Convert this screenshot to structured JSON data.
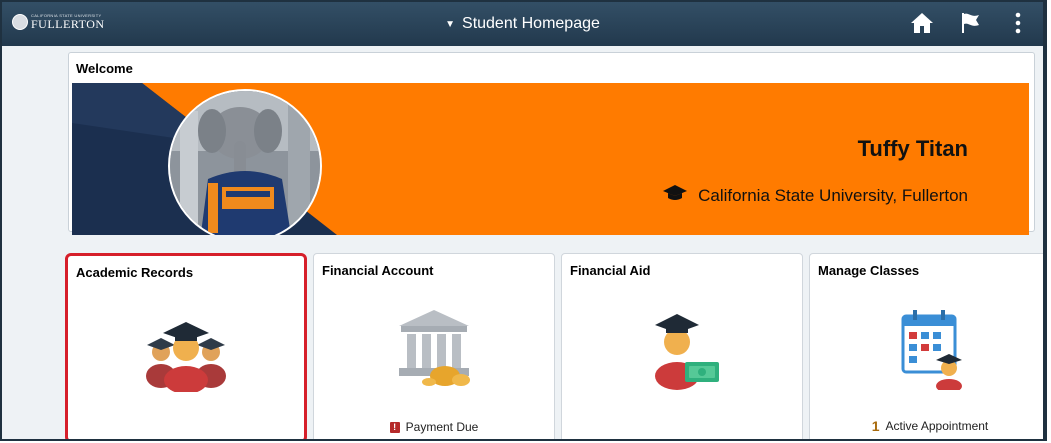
{
  "header": {
    "logo": {
      "small_text": "CALIFORNIA STATE UNIVERSITY",
      "big_text": "FULLERTON"
    },
    "title": "Student Homepage",
    "icons": [
      "caret-down-icon",
      "home-icon",
      "flag-icon",
      "kebab-menu-icon"
    ]
  },
  "welcome": {
    "title": "Welcome",
    "name": "Tuffy Titan",
    "university": "California State University, Fullerton",
    "colors": {
      "accent": "#ff7b00",
      "navy": "#1b2f4f"
    }
  },
  "tiles": [
    {
      "title": "Academic Records",
      "footer": "",
      "selected": true
    },
    {
      "title": "Financial Account",
      "footer": "Payment Due",
      "footer_badge": "!"
    },
    {
      "title": "Financial Aid",
      "footer": ""
    },
    {
      "title": "Manage Classes",
      "footer_count": "1",
      "footer": "Active Appointment"
    }
  ],
  "colors": {
    "header": "#2b4459",
    "selection": "#d61f2a"
  }
}
